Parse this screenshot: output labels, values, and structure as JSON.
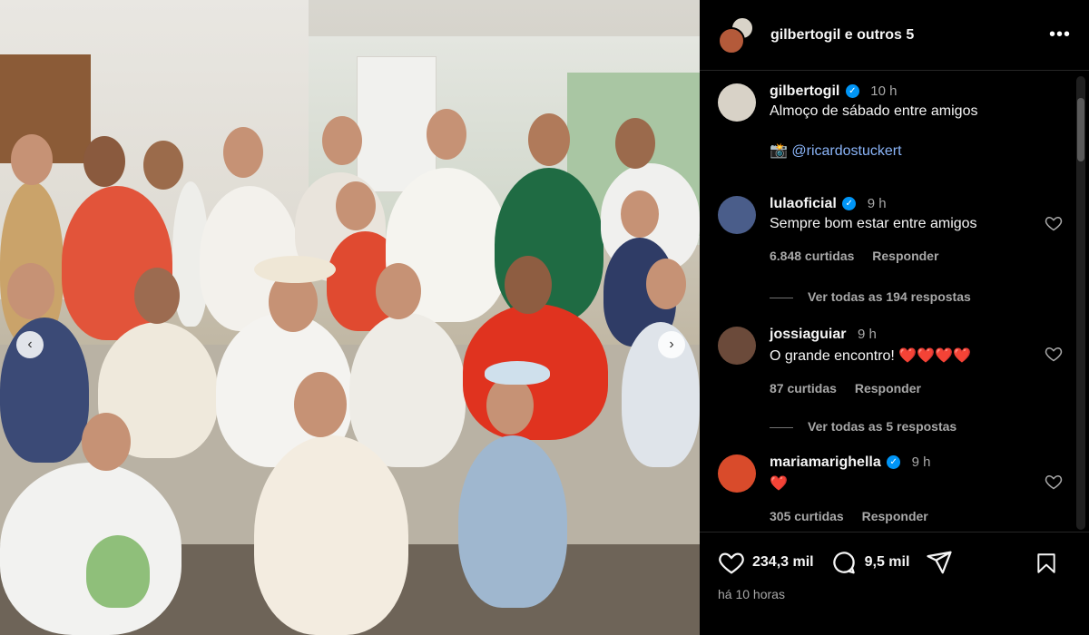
{
  "photo": {
    "prev_label": "‹",
    "next_label": "›"
  },
  "header": {
    "username": "gilbertogil",
    "others": "e outros 5",
    "more_icon": "more-horizontal-icon"
  },
  "comments": [
    {
      "user": "gilbertogil",
      "verified": true,
      "time": "10 h",
      "text": "Almoço de sábado entre amigos",
      "mention_prefix": "📸",
      "mention": "@ricardostuckert"
    },
    {
      "user": "lulaoficial",
      "verified": true,
      "time": "9 h",
      "text": "Sempre bom estar entre amigos",
      "likes": "6.848 curtidas",
      "reply": "Responder",
      "view_replies": "Ver todas as 194 respostas"
    },
    {
      "user": "jossiaguiar",
      "verified": false,
      "time": "9 h",
      "text": "O grande encontro! ❤️❤️❤️❤️",
      "likes": "87 curtidas",
      "reply": "Responder",
      "view_replies": "Ver todas as 5 respostas"
    },
    {
      "user": "mariamarighella",
      "verified": true,
      "time": "9 h",
      "text": "❤️",
      "likes": "305 curtidas",
      "reply": "Responder"
    }
  ],
  "footer": {
    "likes": "234,3 mil",
    "comments": "9,5 mil",
    "time_ago": "há 10 horas"
  },
  "colors": {
    "background": "#000000",
    "text": "#f5f5f5",
    "muted": "#a8a8a8",
    "verified": "#0095f6",
    "link": "#8ab4f8"
  }
}
